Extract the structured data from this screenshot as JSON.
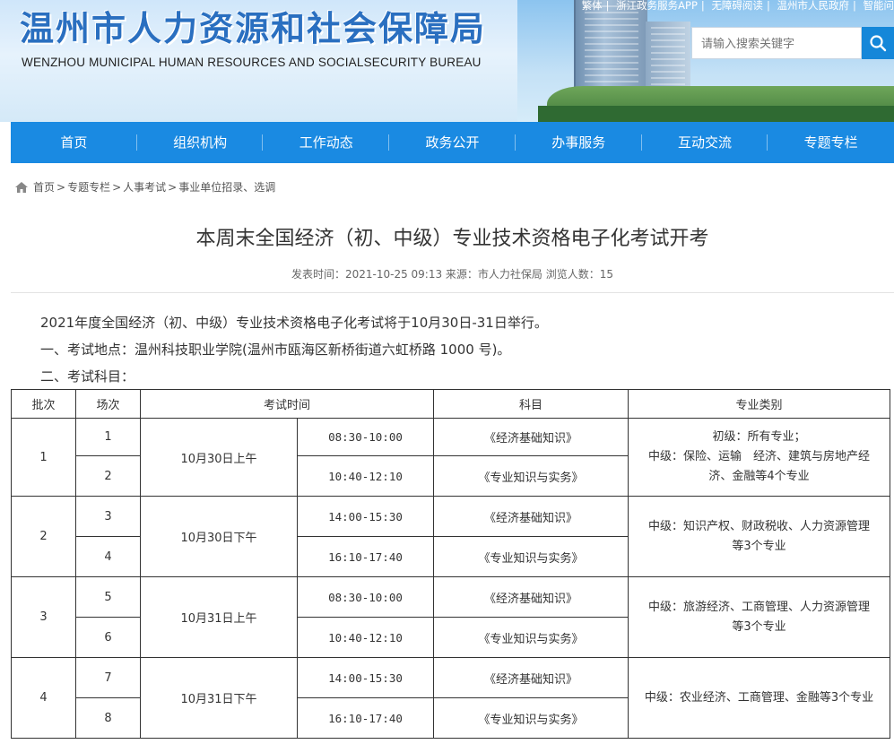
{
  "header": {
    "logo_cn": "温州市人力资源和社会保障局",
    "logo_en": "WENZHOU MUNICIPAL HUMAN RESOURCES AND SOCIALSECURITY BUREAU",
    "top_links": [
      "繁体",
      "浙江政务服务APP",
      "无障碍阅读",
      "温州市人民政府",
      "智能问"
    ],
    "search_placeholder": "请输入搜索关键字",
    "search_icon": "search-icon"
  },
  "nav": {
    "items": [
      "首页",
      "组织机构",
      "工作动态",
      "政务公开",
      "办事服务",
      "互动交流",
      "专题专栏"
    ]
  },
  "breadcrumb": {
    "items": [
      "首页",
      "专题专栏",
      "人事考试",
      "事业单位招录、选调"
    ],
    "separator": ">",
    "icon": "home-icon"
  },
  "article": {
    "title": "本周末全国经济（初、中级）专业技术资格电子化考试开考",
    "meta": "发表时间：2021-10-25 09:13 来源：市人力社保局 浏览人数：15",
    "paragraphs": [
      "2021年度全国经济（初、中级）专业技术资格电子化考试将于10月30日-31日举行。",
      "一、考试地点：温州科技职业学院(温州市瓯海区新桥街道六虹桥路 1000 号)。",
      "二、考试科目："
    ]
  },
  "table": {
    "headers": [
      "批次",
      "场次",
      "考试时间",
      "科目",
      "专业类别"
    ],
    "batches": [
      {
        "batch": "1",
        "date": "10月30日上午",
        "category_lines": [
          "初级：所有专业；",
          "中级：保险、运输　经济、建筑与房地产经",
          "济、金融等4个专业"
        ],
        "sessions": [
          {
            "session": "1",
            "time": "08:30-10:00",
            "subject": "《经济基础知识》"
          },
          {
            "session": "2",
            "time": "10:40-12:10",
            "subject": "《专业知识与实务》"
          }
        ]
      },
      {
        "batch": "2",
        "date": "10月30日下午",
        "category_lines": [
          "中级：知识产权、财政税收、人力资源管理",
          "等3个专业"
        ],
        "sessions": [
          {
            "session": "3",
            "time": "14:00-15:30",
            "subject": "《经济基础知识》"
          },
          {
            "session": "4",
            "time": "16:10-17:40",
            "subject": "《专业知识与实务》"
          }
        ]
      },
      {
        "batch": "3",
        "date": "10月31日上午",
        "category_lines": [
          "中级：旅游经济、工商管理、人力资源管理",
          "等3个专业"
        ],
        "sessions": [
          {
            "session": "5",
            "time": "08:30-10:00",
            "subject": "《经济基础知识》"
          },
          {
            "session": "6",
            "time": "10:40-12:10",
            "subject": "《专业知识与实务》"
          }
        ]
      },
      {
        "batch": "4",
        "date": "10月31日下午",
        "category_lines": [
          "中级：农业经济、工商管理、金融等3个专业"
        ],
        "sessions": [
          {
            "session": "7",
            "time": "14:00-15:30",
            "subject": "《经济基础知识》"
          },
          {
            "session": "8",
            "time": "16:10-17:40",
            "subject": "《专业知识与实务》"
          }
        ]
      }
    ]
  },
  "colors": {
    "brand_blue": "#1a8ae2",
    "logo_blue": "#2a6fc0",
    "search_button": "#1587d9"
  }
}
